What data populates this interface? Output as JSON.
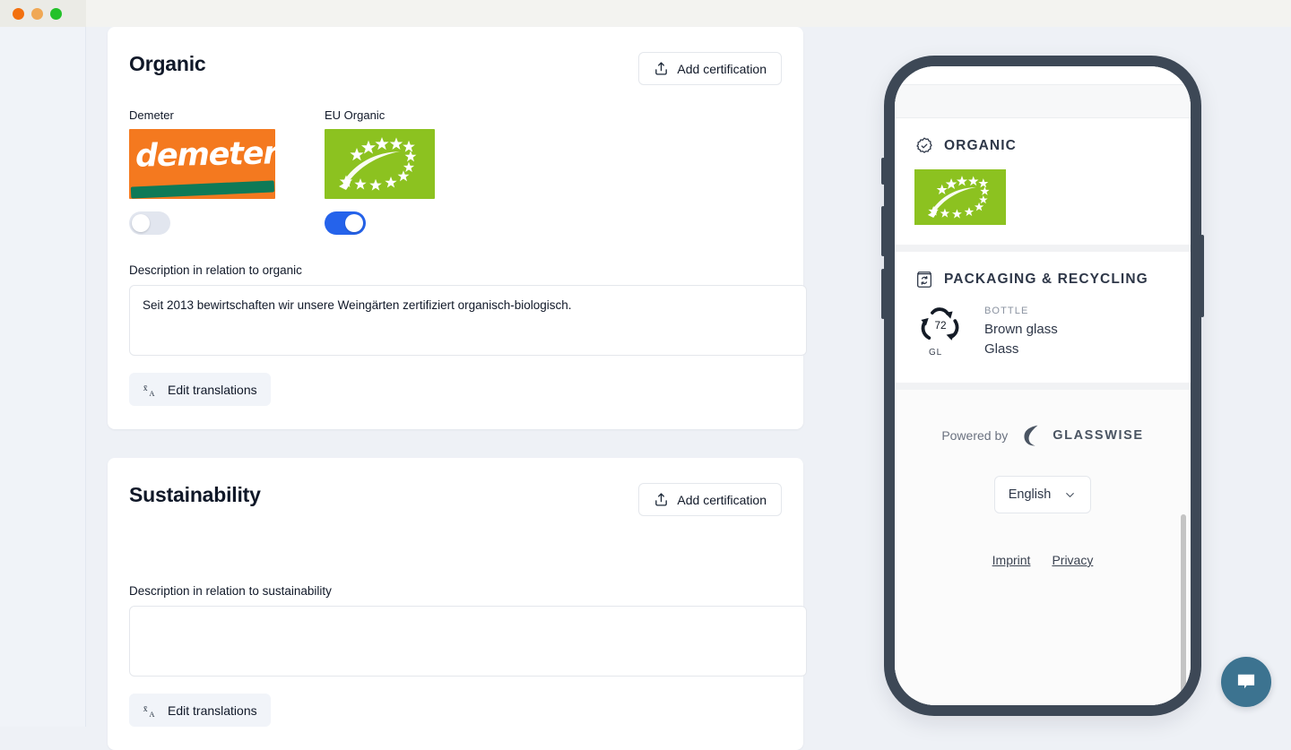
{
  "window": {
    "traffic_lights": [
      "close",
      "minimize",
      "maximize"
    ],
    "colors": {
      "close": "#f2700f",
      "minimize": "#f0a855",
      "maximize": "#23c129"
    }
  },
  "theme": {
    "page_bg": "#eef1f6",
    "card_bg": "#ffffff",
    "accent_toggle_on": "#2563eb",
    "eu_organic_green": "#8cc220",
    "demeter_orange": "#f4791f",
    "demeter_green": "#0e7a57",
    "phone_frame": "#3d4856",
    "chat_fab": "#3c7390"
  },
  "sections": [
    {
      "id": "organic",
      "title": "Organic",
      "add_button": {
        "label": "Add certification",
        "icon": "upload-icon"
      },
      "certifications": [
        {
          "name": "Demeter",
          "logo": "demeter-logo",
          "enabled": false
        },
        {
          "name": "EU Organic",
          "logo": "eu-organic-logo",
          "enabled": true
        }
      ],
      "description": {
        "label": "Description in relation to organic",
        "value": "Seit 2013 bewirtschaften wir unsere Weingärten zertifiziert organisch-biologisch.",
        "placeholder": ""
      },
      "translations_button": {
        "label": "Edit translations",
        "icon": "translate-icon"
      }
    },
    {
      "id": "sustainability",
      "title": "Sustainability",
      "add_button": {
        "label": "Add certification",
        "icon": "upload-icon"
      },
      "certifications": [],
      "description": {
        "label": "Description in relation to sustainability",
        "value": "",
        "placeholder": ""
      },
      "translations_button": {
        "label": "Edit translations",
        "icon": "translate-icon"
      }
    }
  ],
  "preview": {
    "organic": {
      "heading": "ORGANIC",
      "heading_icon": "certificate-badge-icon",
      "logo": "eu-organic-logo"
    },
    "packaging": {
      "heading": "PACKAGING & RECYCLING",
      "heading_icon": "recycle-bin-icon",
      "item": {
        "recycling_code": "72",
        "recycling_material_code": "GL",
        "kicker": "BOTTLE",
        "line1": "Brown glass",
        "line2": "Glass"
      }
    },
    "footer": {
      "powered_by": "Powered by",
      "brand": "GLASSWISE",
      "brand_icon": "glasswise-crescent-icon",
      "language_select": {
        "value": "English",
        "icon": "chevron-down-icon"
      },
      "links": [
        {
          "label": "Imprint"
        },
        {
          "label": "Privacy"
        }
      ]
    }
  },
  "chat": {
    "icon": "chat-bubble-icon"
  }
}
